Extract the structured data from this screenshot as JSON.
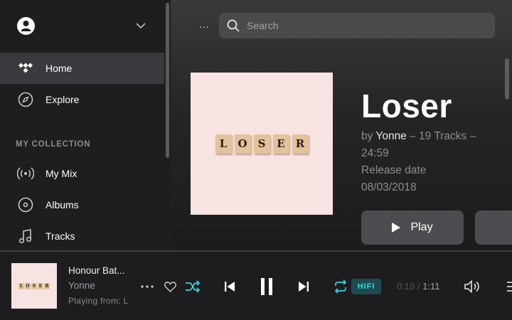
{
  "sidebar": {
    "nav": [
      {
        "label": "Home",
        "icon": "tidal-logo-icon",
        "active": true
      },
      {
        "label": "Explore",
        "icon": "compass-icon",
        "active": false
      }
    ],
    "section_heading": "MY COLLECTION",
    "collection": [
      {
        "label": "My Mix",
        "icon": "radio-waves-icon"
      },
      {
        "label": "Albums",
        "icon": "disc-icon"
      },
      {
        "label": "Tracks",
        "icon": "music-note-icon"
      }
    ]
  },
  "header": {
    "more_label": "...",
    "search_placeholder": "Search"
  },
  "album": {
    "title": "Loser",
    "by_prefix": "by",
    "artist": "Yonne",
    "tracks_text": "– 19 Tracks –",
    "duration": "24:59",
    "release_label": "Release date",
    "release_date": "08/03/2018",
    "cover_letters": [
      "L",
      "O",
      "S",
      "E",
      "R"
    ],
    "play_label": "Play"
  },
  "player": {
    "track_title": "Honour Bat...",
    "artist": "Yonne",
    "playing_from": "Playing from:  L",
    "quality_badge": "HIFI",
    "elapsed": "0:19",
    "time_separator": "/",
    "total": "1:11",
    "accent_color": "#34d7e2"
  }
}
